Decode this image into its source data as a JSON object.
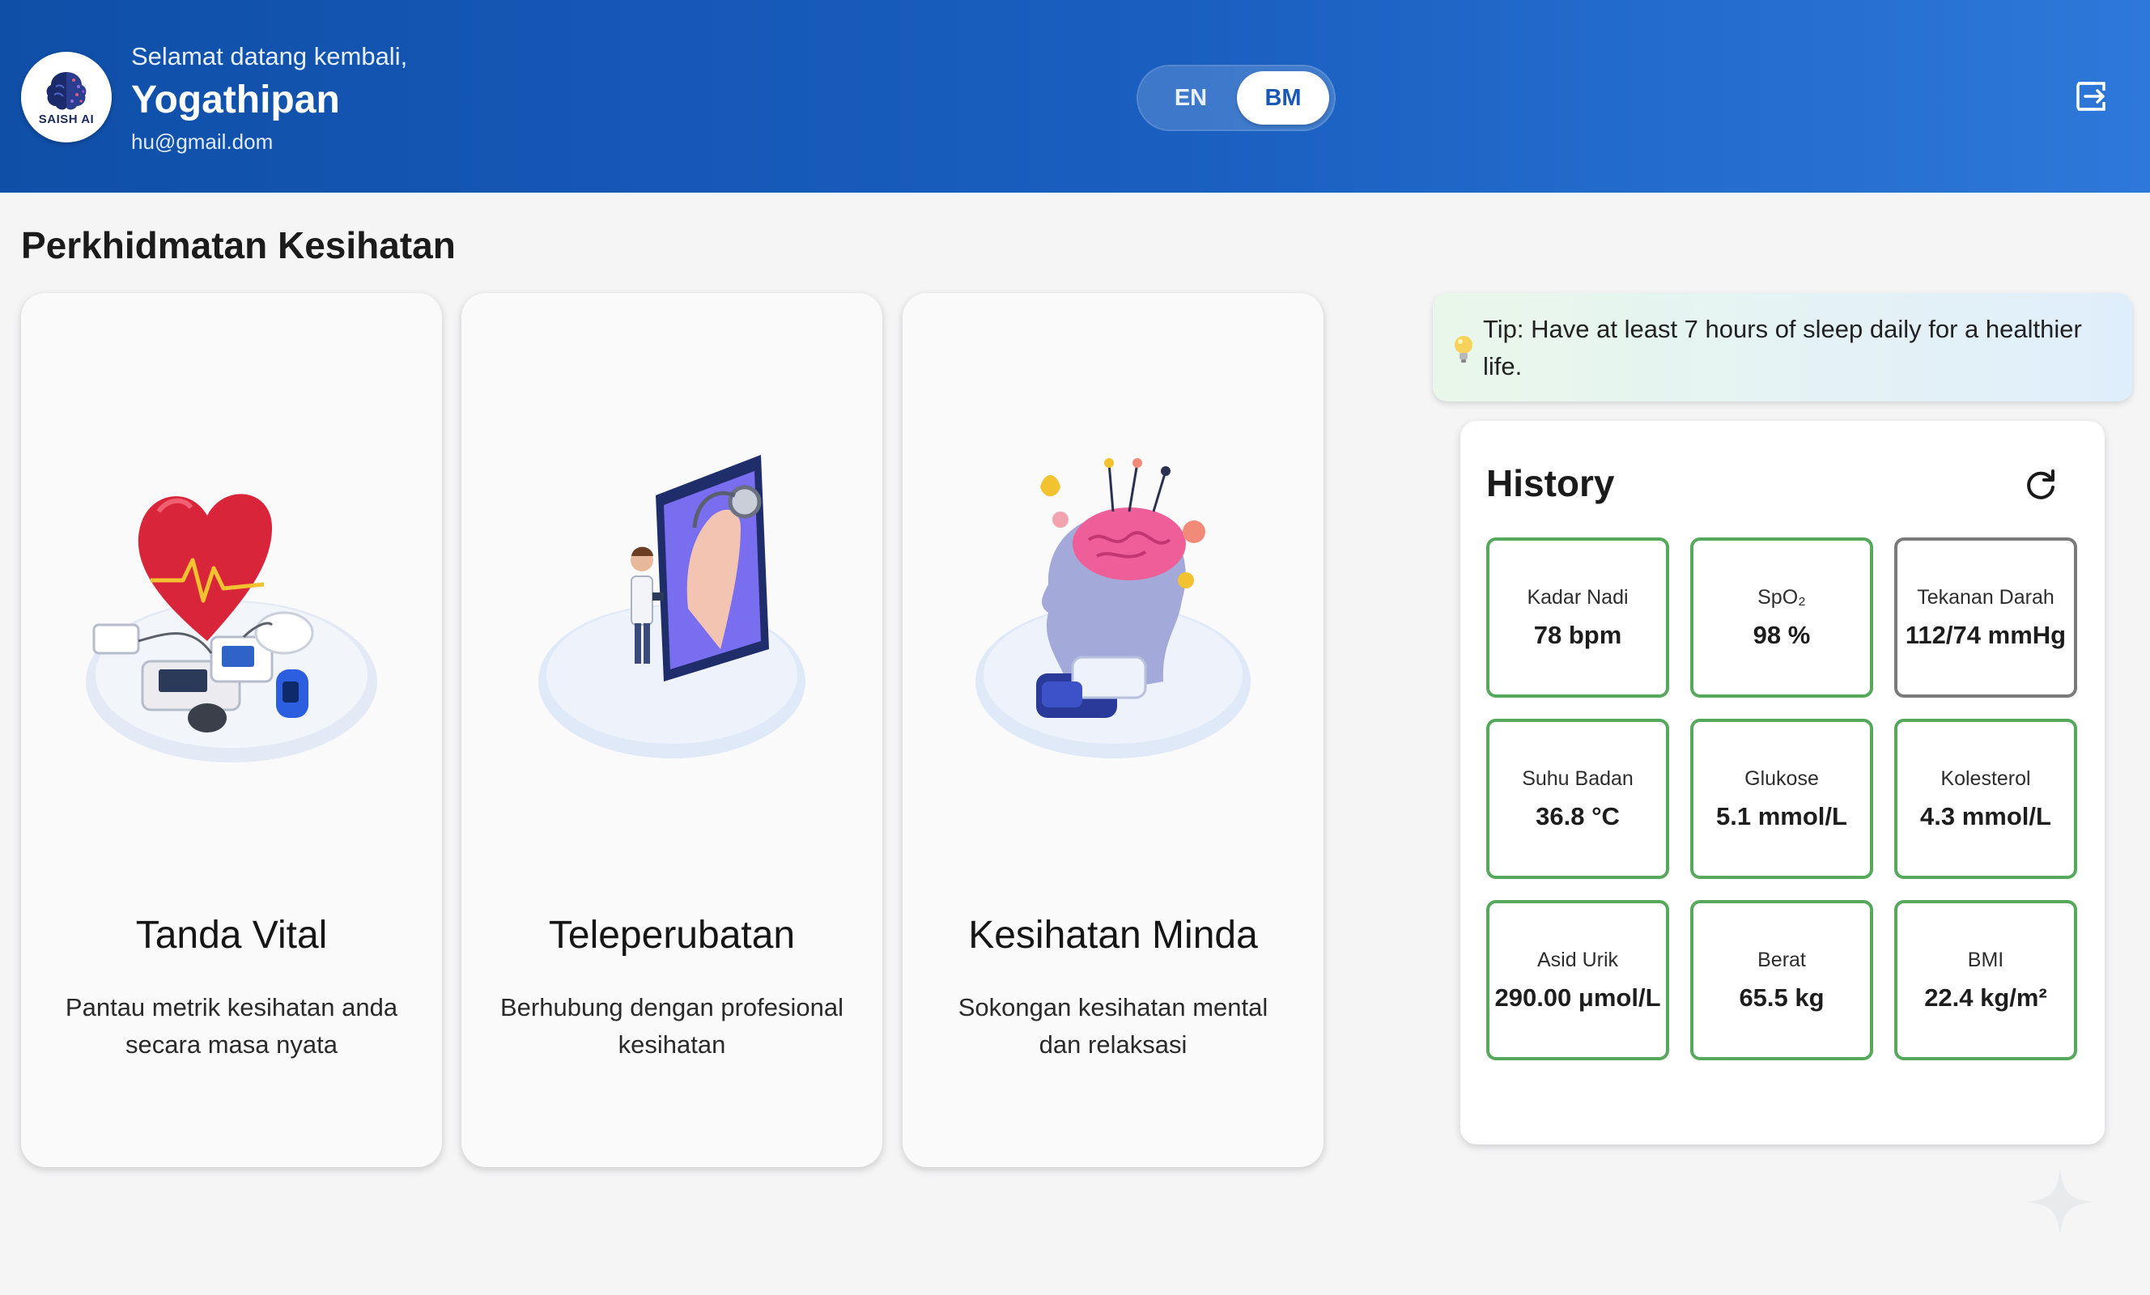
{
  "header": {
    "logo_text": "SAISH AI",
    "welcome": "Selamat datang kembali,",
    "username": "Yogathipan",
    "email": "hu@gmail.dom",
    "lang_en": "EN",
    "lang_bm": "BM",
    "active_language": "BM",
    "logout_icon": "logout-icon"
  },
  "section_title": "Perkhidmatan Kesihatan",
  "services": [
    {
      "title": "Tanda Vital",
      "description": "Pantau metrik kesihatan anda secara masa nyata",
      "icon": "heart-monitor-illustration"
    },
    {
      "title": "Teleperubatan",
      "description": "Berhubung dengan profesional kesihatan",
      "icon": "telemedicine-illustration"
    },
    {
      "title": "Kesihatan Minda",
      "description": "Sokongan kesihatan mental dan relaksasi",
      "icon": "mind-health-illustration"
    }
  ],
  "tip": {
    "text": "Tip: Have at least 7 hours of sleep daily for a healthier life.",
    "icon": "lightbulb-icon"
  },
  "history": {
    "title": "History",
    "refresh_icon": "refresh-icon",
    "metrics": [
      {
        "label": "Kadar Nadi",
        "value": "78 bpm"
      },
      {
        "label": "SpO₂",
        "value": "98 %"
      },
      {
        "label": "Tekanan Darah",
        "value": "112/74 mmHg"
      },
      {
        "label": "Suhu Badan",
        "value": "36.8 °C"
      },
      {
        "label": "Glukose",
        "value": "5.1 mmol/L"
      },
      {
        "label": "Kolesterol",
        "value": "4.3 mmol/L"
      },
      {
        "label": "Asid Urik",
        "value": "290.00 μmol/L"
      },
      {
        "label": "Berat",
        "value": "65.5 kg"
      },
      {
        "label": "BMI",
        "value": "22.4 kg/m²"
      }
    ]
  },
  "colors": {
    "header_primary": "#1a5fc0",
    "metric_border_normal": "#55a85c",
    "metric_border_neutral": "#7a7a7a",
    "lang_active_text": "#1a58b8"
  }
}
